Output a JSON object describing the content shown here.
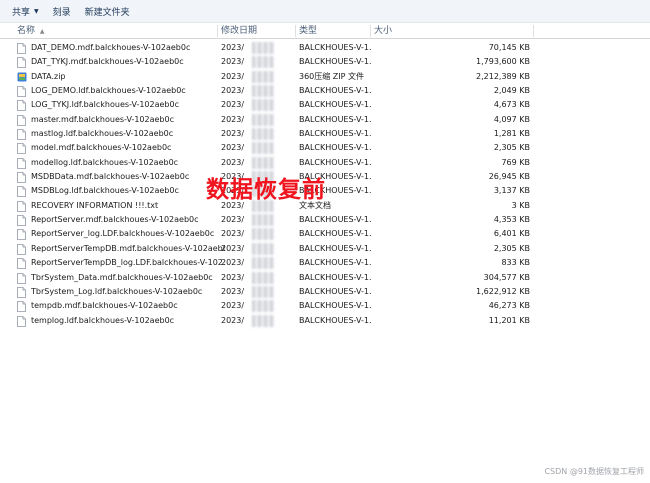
{
  "toolbar": {
    "share_label": "共享",
    "burn_label": "刻录",
    "new_folder_label": "新建文件夹"
  },
  "columns": {
    "name": "名称",
    "date": "修改日期",
    "type": "类型",
    "size": "大小"
  },
  "files": [
    {
      "name": "DAT_DEMO.mdf.balckhoues-V-102aeb0c",
      "date": "2023/",
      "type": "BALCKHOUES-V-1...",
      "size": "70,145 KB",
      "icon": "file-icon"
    },
    {
      "name": "DAT_TYKJ.mdf.balckhoues-V-102aeb0c",
      "date": "2023/",
      "type": "BALCKHOUES-V-1...",
      "size": "1,793,600 KB",
      "icon": "file-icon"
    },
    {
      "name": "DATA.zip",
      "date": "2023/",
      "type": "360压缩 ZIP 文件",
      "size": "2,212,389 KB",
      "icon": "zip-icon"
    },
    {
      "name": "LOG_DEMO.ldf.balckhoues-V-102aeb0c",
      "date": "2023/",
      "type": "BALCKHOUES-V-1...",
      "size": "2,049 KB",
      "icon": "file-icon"
    },
    {
      "name": "LOG_TYKJ.ldf.balckhoues-V-102aeb0c",
      "date": "2023/",
      "type": "BALCKHOUES-V-1...",
      "size": "4,673 KB",
      "icon": "file-icon"
    },
    {
      "name": "master.mdf.balckhoues-V-102aeb0c",
      "date": "2023/",
      "type": "BALCKHOUES-V-1...",
      "size": "4,097 KB",
      "icon": "file-icon"
    },
    {
      "name": "mastlog.ldf.balckhoues-V-102aeb0c",
      "date": "2023/",
      "type": "BALCKHOUES-V-1...",
      "size": "1,281 KB",
      "icon": "file-icon"
    },
    {
      "name": "model.mdf.balckhoues-V-102aeb0c",
      "date": "2023/",
      "type": "BALCKHOUES-V-1...",
      "size": "2,305 KB",
      "icon": "file-icon"
    },
    {
      "name": "modellog.ldf.balckhoues-V-102aeb0c",
      "date": "2023/",
      "type": "BALCKHOUES-V-1...",
      "size": "769 KB",
      "icon": "file-icon"
    },
    {
      "name": "MSDBData.mdf.balckhoues-V-102aeb0c",
      "date": "2023/",
      "type": "BALCKHOUES-V-1...",
      "size": "26,945 KB",
      "icon": "file-icon"
    },
    {
      "name": "MSDBLog.ldf.balckhoues-V-102aeb0c",
      "date": "2023/",
      "type": "BALCKHOUES-V-1...",
      "size": "3,137 KB",
      "icon": "file-icon"
    },
    {
      "name": "RECOVERY INFORMATION !!!.txt",
      "date": "2023/",
      "type": "文本文档",
      "size": "3 KB",
      "icon": "file-icon"
    },
    {
      "name": "ReportServer.mdf.balckhoues-V-102aeb0c",
      "date": "2023/",
      "type": "BALCKHOUES-V-1...",
      "size": "4,353 KB",
      "icon": "file-icon"
    },
    {
      "name": "ReportServer_log.LDF.balckhoues-V-102aeb0c",
      "date": "2023/",
      "type": "BALCKHOUES-V-1...",
      "size": "6,401 KB",
      "icon": "file-icon"
    },
    {
      "name": "ReportServerTempDB.mdf.balckhoues-V-102aeb0c",
      "date": "2023/",
      "type": "BALCKHOUES-V-1...",
      "size": "2,305 KB",
      "icon": "file-icon"
    },
    {
      "name": "ReportServerTempDB_log.LDF.balckhoues-V-102...",
      "date": "2023/",
      "type": "BALCKHOUES-V-1...",
      "size": "833 KB",
      "icon": "file-icon"
    },
    {
      "name": "TbrSystem_Data.mdf.balckhoues-V-102aeb0c",
      "date": "2023/",
      "type": "BALCKHOUES-V-1...",
      "size": "304,577 KB",
      "icon": "file-icon"
    },
    {
      "name": "TbrSystem_Log.ldf.balckhoues-V-102aeb0c",
      "date": "2023/",
      "type": "BALCKHOUES-V-1...",
      "size": "1,622,912 KB",
      "icon": "file-icon"
    },
    {
      "name": "tempdb.mdf.balckhoues-V-102aeb0c",
      "date": "2023/",
      "type": "BALCKHOUES-V-1...",
      "size": "46,273 KB",
      "icon": "file-icon"
    },
    {
      "name": "templog.ldf.balckhoues-V-102aeb0c",
      "date": "2023/",
      "type": "BALCKHOUES-V-1...",
      "size": "11,201 KB",
      "icon": "file-icon"
    }
  ],
  "overlay_text": "数据恢复前",
  "watermark": "CSDN @91数据恢复工程师",
  "colors": {
    "overlay": "#f0141e",
    "toolbar_bg": "#f1f4f8",
    "toolbar_text": "#1e395b"
  }
}
